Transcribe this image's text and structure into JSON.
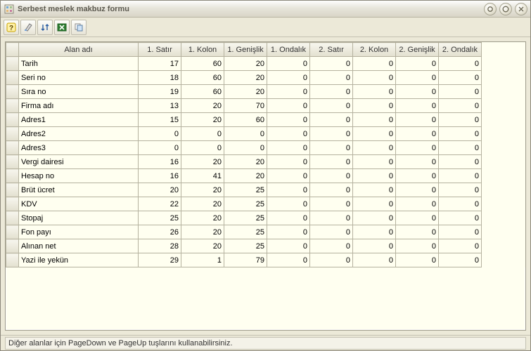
{
  "window": {
    "title": "Serbest meslek makbuz formu"
  },
  "toolbar": {
    "buttons": [
      {
        "name": "help-icon"
      },
      {
        "name": "palette-icon"
      },
      {
        "name": "sort-icon"
      },
      {
        "name": "excel-icon"
      },
      {
        "name": "copy-icon"
      }
    ]
  },
  "grid": {
    "columns": [
      "Alan adı",
      "1. Satır",
      "1. Kolon",
      "1. Genişlik",
      "1. Ondalık",
      "2. Satır",
      "2. Kolon",
      "2. Genişlik",
      "2. Ondalık"
    ],
    "rows": [
      {
        "name": "Tarih",
        "v": [
          17,
          60,
          20,
          0,
          0,
          0,
          0,
          0
        ]
      },
      {
        "name": "Seri no",
        "v": [
          18,
          60,
          20,
          0,
          0,
          0,
          0,
          0
        ]
      },
      {
        "name": "Sıra no",
        "v": [
          19,
          60,
          20,
          0,
          0,
          0,
          0,
          0
        ]
      },
      {
        "name": "Firma adı",
        "v": [
          13,
          20,
          70,
          0,
          0,
          0,
          0,
          0
        ]
      },
      {
        "name": "Adres1",
        "v": [
          15,
          20,
          60,
          0,
          0,
          0,
          0,
          0
        ]
      },
      {
        "name": "Adres2",
        "v": [
          0,
          0,
          0,
          0,
          0,
          0,
          0,
          0
        ]
      },
      {
        "name": "Adres3",
        "v": [
          0,
          0,
          0,
          0,
          0,
          0,
          0,
          0
        ]
      },
      {
        "name": "Vergi dairesi",
        "v": [
          16,
          20,
          20,
          0,
          0,
          0,
          0,
          0
        ]
      },
      {
        "name": "Hesap no",
        "v": [
          16,
          41,
          20,
          0,
          0,
          0,
          0,
          0
        ]
      },
      {
        "name": "Brüt ücret",
        "v": [
          20,
          20,
          25,
          0,
          0,
          0,
          0,
          0
        ]
      },
      {
        "name": "KDV",
        "v": [
          22,
          20,
          25,
          0,
          0,
          0,
          0,
          0
        ]
      },
      {
        "name": "Stopaj",
        "v": [
          25,
          20,
          25,
          0,
          0,
          0,
          0,
          0
        ]
      },
      {
        "name": "Fon payı",
        "v": [
          26,
          20,
          25,
          0,
          0,
          0,
          0,
          0
        ]
      },
      {
        "name": "Alınan net",
        "v": [
          28,
          20,
          25,
          0,
          0,
          0,
          0,
          0
        ]
      },
      {
        "name": "Yazi ile yekün",
        "v": [
          29,
          1,
          79,
          0,
          0,
          0,
          0,
          0
        ]
      }
    ]
  },
  "statusbar": {
    "text": "Diğer alanlar için PageDown ve PageUp tuşlarını kullanabilirsiniz."
  }
}
